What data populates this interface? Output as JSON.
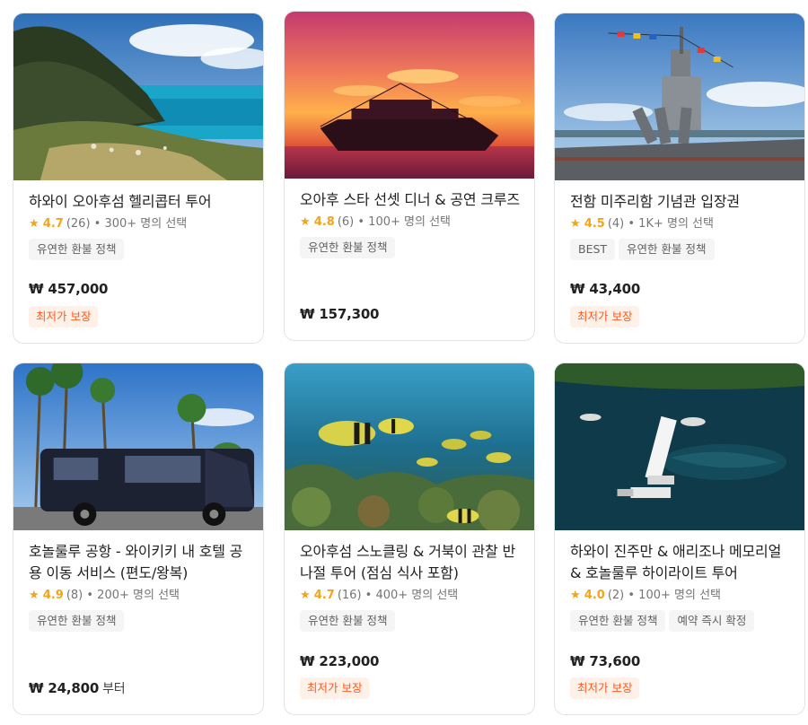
{
  "cards": [
    {
      "title": "하와이 오아후섬 헬리콥터 투어",
      "star": "★",
      "score": "4.7",
      "reviews": "(26) • 300+ 명의 선택",
      "tags": [
        "유연한 환불 정책"
      ],
      "price": "₩ 457,000",
      "badge": "최저가 보장"
    },
    {
      "title": "오아후 스타 선셋 디너 & 공연 크루즈",
      "star": "★",
      "score": "4.8",
      "reviews": "(6) • 100+ 명의 선택",
      "tags": [
        "유연한 환불 정책"
      ],
      "price": "₩ 157,300"
    },
    {
      "title": "전함 미주리함 기념관 입장권",
      "star": "★",
      "score": "4.5",
      "reviews": "(4) • 1K+ 명의 선택",
      "tags": [
        "BEST",
        "유연한 환불 정책"
      ],
      "price": "₩ 43,400",
      "badge": "최저가 보장"
    },
    {
      "title": "호놀룰루 공항 - 와이키키 내 호텔 공용 이동 서비스 (편도/왕복)",
      "star": "★",
      "score": "4.9",
      "reviews": "(8) • 200+ 명의 선택",
      "tags": [
        "유연한 환불 정책"
      ],
      "price": "₩ 24,800",
      "price_suffix": "부터"
    },
    {
      "title": "오아후섬 스노클링 & 거북이 관찰 반나절 투어 (점심 식사 포함)",
      "star": "★",
      "score": "4.7",
      "reviews": "(16) • 400+ 명의 선택",
      "tags": [
        "유연한 환불 정책"
      ],
      "price": "₩ 223,000",
      "badge": "최저가 보장"
    },
    {
      "title": "하와이 진주만 & 애리조나 메모리얼 & 호놀룰루 하이라이트 투어",
      "star": "★",
      "score": "4.0",
      "reviews": "(2) • 100+ 명의 선택",
      "tags": [
        "유연한 환불 정책",
        "예약 즉시 확정"
      ],
      "price": "₩ 73,600",
      "badge": "최저가 보장"
    }
  ],
  "colors": {
    "accent": "#ff5b22",
    "star": "#f2a51a",
    "badge_bg": "#fff0e8",
    "tag_bg": "#f5f5f5"
  }
}
